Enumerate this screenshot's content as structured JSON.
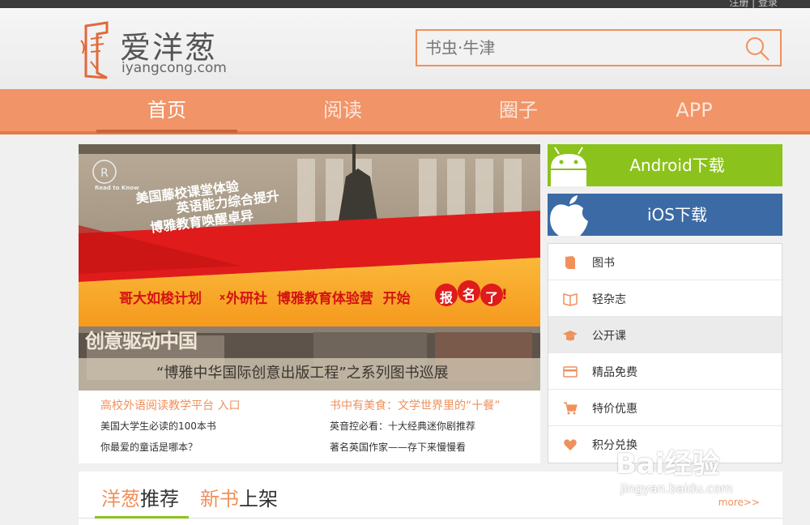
{
  "topbar": {
    "links": "注册 | 登录"
  },
  "brand": {
    "name": "爱洋葱",
    "domain": "iyangcong.com"
  },
  "search": {
    "placeholder": "书虫·牛津"
  },
  "nav": {
    "items": [
      {
        "label": "首页",
        "active": true
      },
      {
        "label": "阅读"
      },
      {
        "label": "圈子"
      },
      {
        "label": "APP"
      }
    ]
  },
  "banner": {
    "logo_text": "Read to Know",
    "line1": "美国藤校课堂体验",
    "line2": "英语能力综合提升",
    "line3": "博雅教育唤醒卓异",
    "main": "哥大如梭计划",
    "x": "x",
    "main2": "外研社  博雅教育体验营  开始",
    "baoming1": "报",
    "baoming2": "名",
    "baoming3": "了",
    "excl": "!",
    "lower_title": "创意驱动中国",
    "lower_caption": "“博雅中华国际创意出版工程”之系列图书巡展"
  },
  "news": {
    "left_headline": "高校外语阅读教学平台 入口",
    "left_items": [
      "美国大学生必读的100本书",
      "你最爱的童话是哪本？"
    ],
    "right_headline": "书中有美食：文学世界里的“十餐”",
    "right_items": [
      "英音控必看：十大经典迷你剧推荐",
      "著名英国作家——存下来慢慢看"
    ]
  },
  "downloads": {
    "android": "Android下载",
    "ios": "iOS下载"
  },
  "categories": [
    {
      "label": "图书",
      "icon": "book-icon"
    },
    {
      "label": "轻杂志",
      "icon": "open-book-icon"
    },
    {
      "label": "公开课",
      "icon": "graduation-cap-icon"
    },
    {
      "label": "精品免费",
      "icon": "card-icon"
    },
    {
      "label": "特价优惠",
      "icon": "cart-icon"
    },
    {
      "label": "积分兑换",
      "icon": "heart-icon"
    }
  ],
  "recommend": {
    "tab1_o": "洋葱",
    "tab1_d": "推荐",
    "tab2_o": "新书",
    "tab2_d": "上架",
    "more": "more>>"
  },
  "watermark": {
    "big": "Bai经验",
    "small": "jingyan.baidu.com"
  },
  "colors": {
    "accent": "#f19468",
    "android": "#8bc21b",
    "ios": "#3b6aa5"
  }
}
